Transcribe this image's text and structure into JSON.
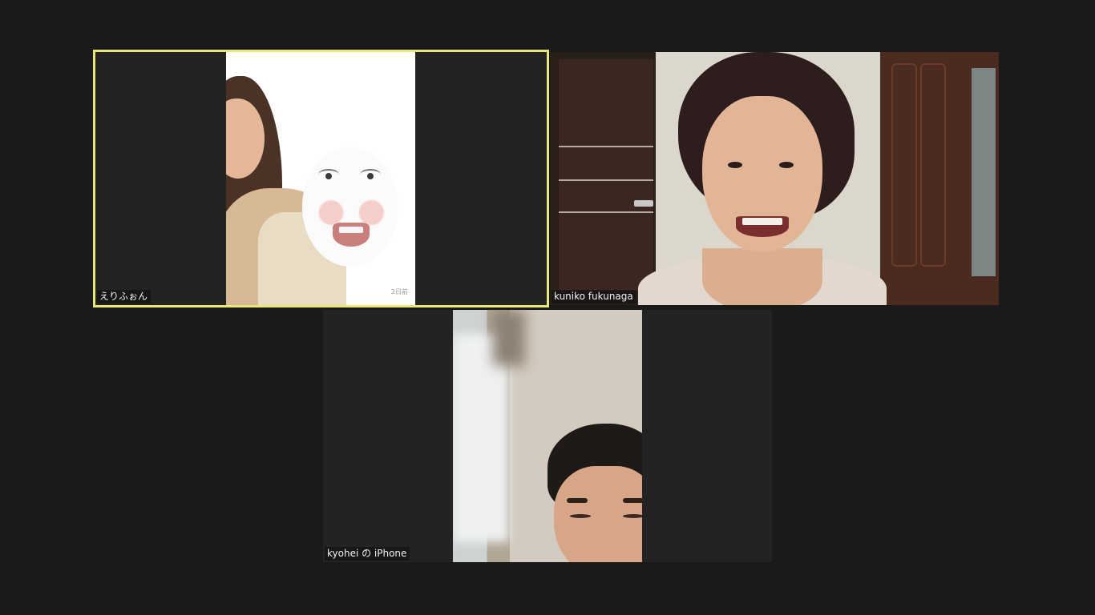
{
  "participants": [
    {
      "name": "えりふぉん",
      "active_speaker": true,
      "overlay_text": "2日前"
    },
    {
      "name": "kuniko fukunaga",
      "active_speaker": false
    },
    {
      "name": "kyohei の iPhone",
      "active_speaker": false
    }
  ],
  "colors": {
    "background": "#1a1a1a",
    "tile_background": "#232323",
    "active_speaker_border": "#e8e87a",
    "label_text": "#f2f2f2"
  }
}
